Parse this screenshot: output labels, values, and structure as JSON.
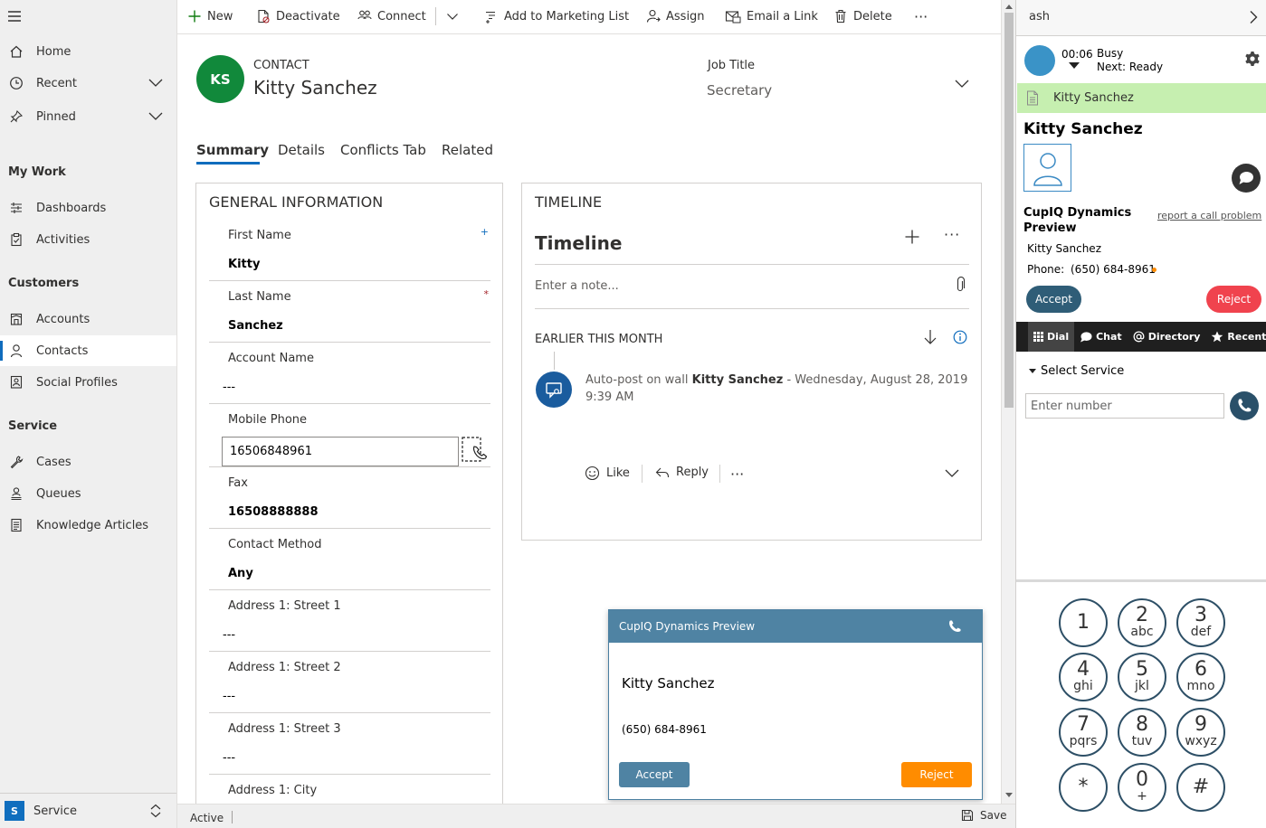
{
  "sidenav": {
    "home": "Home",
    "recent": "Recent",
    "pinned": "Pinned",
    "group_my_work": "My Work",
    "dashboards": "Dashboards",
    "activities": "Activities",
    "group_customers": "Customers",
    "accounts": "Accounts",
    "contacts": "Contacts",
    "social_profiles": "Social Profiles",
    "group_service": "Service",
    "cases": "Cases",
    "queues": "Queues",
    "knowledge_articles": "Knowledge Articles",
    "area_badge": "S",
    "area_name": "Service"
  },
  "commandbar": {
    "new": "New",
    "deactivate": "Deactivate",
    "connect": "Connect",
    "add_to_marketing_list": "Add to Marketing List",
    "assign": "Assign",
    "email_a_link": "Email a Link",
    "delete": "Delete",
    "more": "···"
  },
  "header": {
    "initials": "KS",
    "entity_type": "CONTACT",
    "record_name": "Kitty Sanchez",
    "job_title_label": "Job Title",
    "job_title_value": "Secretary"
  },
  "tabs": [
    "Summary",
    "Details",
    "Conflicts Tab",
    "Related"
  ],
  "general": {
    "title": "GENERAL INFORMATION",
    "first_name_label": "First Name",
    "first_name_value": "Kitty",
    "recommended_marker": "+",
    "last_name_label": "Last Name",
    "last_name_value": "Sanchez",
    "required_marker": "*",
    "account_name_label": "Account Name",
    "account_name_value": "---",
    "mobile_phone_label": "Mobile Phone",
    "mobile_phone_value": "16506848961",
    "fax_label": "Fax",
    "fax_value": "16508888888",
    "contact_method_label": "Contact Method",
    "contact_method_value": "Any",
    "street1_label": "Address 1: Street 1",
    "street1_value": "---",
    "street2_label": "Address 1: Street 2",
    "street2_value": "---",
    "street3_label": "Address 1: Street 3",
    "street3_value": "---",
    "city_label": "Address 1: City"
  },
  "timeline": {
    "caption": "TIMELINE",
    "title": "Timeline",
    "more": "···",
    "note_placeholder": "Enter a note...",
    "period": "EARLIER THIS MONTH",
    "post_prefix": "Auto-post on wall",
    "post_name": "Kitty Sanchez",
    "post_suffix": "-  Wednesday, August 28, 2019 9:39 AM",
    "like": "Like",
    "reply": "Reply",
    "more_actions": "···"
  },
  "popup": {
    "title": "CupIQ Dynamics Preview",
    "caller_name": "Kitty Sanchez",
    "caller_number": "(650) 684-8961",
    "accept": "Accept",
    "reject": "Reject"
  },
  "statusbar": {
    "status": "Active",
    "save": "Save"
  },
  "cti": {
    "user": "ash",
    "timer": "00:06",
    "status": "Busy",
    "next_status": "Next: Ready",
    "active_call_name": "Kitty Sanchez",
    "contact_name": "Kitty Sanchez",
    "app_title": "CupIQ Dynamics Preview",
    "report_link": "report a call problem",
    "caller_name": "Kitty Sanchez",
    "phone_label": "Phone:",
    "phone_value": "(650) 684-8961",
    "accept": "Accept",
    "reject": "Reject",
    "tab_dial": "Dial",
    "tab_chat": "Chat",
    "tab_directory": "Directory",
    "tab_recent": "Recent",
    "select_service": "Select Service",
    "number_placeholder": "Enter number"
  },
  "keypad": [
    {
      "digit": "1",
      "letters": ""
    },
    {
      "digit": "2",
      "letters": "abc"
    },
    {
      "digit": "3",
      "letters": "def"
    },
    {
      "digit": "4",
      "letters": "ghi"
    },
    {
      "digit": "5",
      "letters": "jkl"
    },
    {
      "digit": "6",
      "letters": "mno"
    },
    {
      "digit": "7",
      "letters": "pqrs"
    },
    {
      "digit": "8",
      "letters": "tuv"
    },
    {
      "digit": "9",
      "letters": "wxyz"
    },
    {
      "digit": "*",
      "letters": ""
    },
    {
      "digit": "0",
      "letters": "+"
    },
    {
      "digit": "#",
      "letters": ""
    }
  ],
  "colors": {
    "accent_blue": "#0f6cbd",
    "avatar_green": "#11893b",
    "popup_header": "#4f83a3",
    "reject_orange": "#ff8c00",
    "cti_reject_red": "#f0434e",
    "active_call_green": "#c6efb0"
  }
}
